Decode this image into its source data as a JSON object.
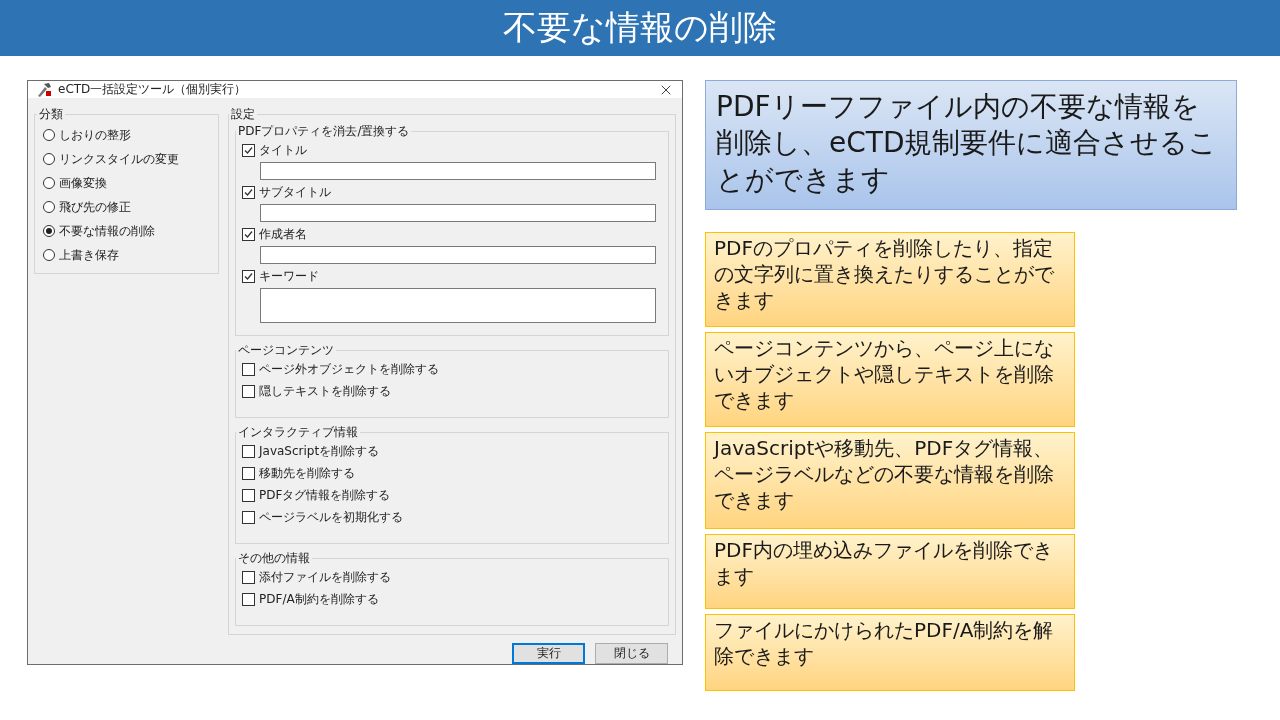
{
  "slide_title": "不要な情報の削除",
  "dialog": {
    "title": "eCTD一括設定ツール（個別実行）",
    "category": {
      "label": "分類",
      "options": [
        {
          "label": "しおりの整形",
          "selected": false
        },
        {
          "label": "リンクスタイルの変更",
          "selected": false
        },
        {
          "label": "画像変換",
          "selected": false
        },
        {
          "label": "飛び先の修正",
          "selected": false
        },
        {
          "label": "不要な情報の削除",
          "selected": true
        },
        {
          "label": "上書き保存",
          "selected": false
        }
      ]
    },
    "settings": {
      "label": "設定",
      "groups": [
        {
          "label": "PDFプロパティを消去/置換する",
          "items": [
            {
              "kind": "field",
              "label": "タイトル",
              "checked": true
            },
            {
              "kind": "field",
              "label": "サブタイトル",
              "checked": true
            },
            {
              "kind": "field",
              "label": "作成者名",
              "checked": true
            },
            {
              "kind": "textarea",
              "label": "キーワード",
              "checked": true
            }
          ]
        },
        {
          "label": "ページコンテンツ",
          "items": [
            {
              "kind": "plain",
              "label": "ページ外オブジェクトを削除する",
              "checked": false
            },
            {
              "kind": "plain",
              "label": "隠しテキストを削除する",
              "checked": false
            }
          ]
        },
        {
          "label": "インタラクティブ情報",
          "items": [
            {
              "kind": "plain",
              "label": "JavaScriptを削除する",
              "checked": false
            },
            {
              "kind": "plain",
              "label": "移動先を削除する",
              "checked": false
            },
            {
              "kind": "plain",
              "label": "PDFタグ情報を削除する",
              "checked": false
            },
            {
              "kind": "plain",
              "label": "ページラベルを初期化する",
              "checked": false
            }
          ]
        },
        {
          "label": "その他の情報",
          "items": [
            {
              "kind": "plain",
              "label": "添付ファイルを削除する",
              "checked": false
            },
            {
              "kind": "plain",
              "label": "PDF/A制約を削除する",
              "checked": false
            }
          ]
        }
      ]
    },
    "buttons": [
      {
        "label": "実行",
        "default": true
      },
      {
        "label": "閉じる",
        "default": false
      }
    ]
  },
  "summary": "PDFリーフファイル内の不要な情報を削除し、eCTD規制要件に適合させることができます",
  "notes": [
    "PDFのプロパティを削除したり、指定の文字列に置き換えたりすることができます",
    "ページコンテンツから、ページ上にないオブジェクトや隠しテキストを削除できます",
    "JavaScriptや移動先、PDFタグ情報、ページラベルなどの不要な情報を削除できます",
    "PDF内の埋め込みファイルを削除できます",
    "ファイルにかけられたPDF/A制約を解除できます"
  ]
}
